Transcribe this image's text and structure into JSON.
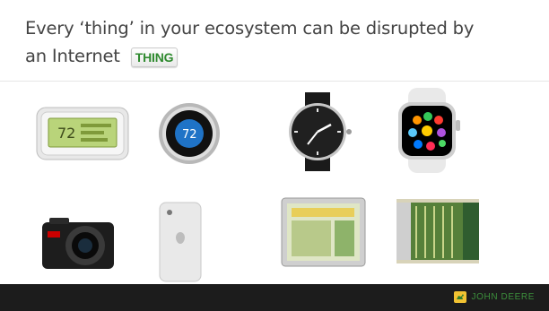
{
  "slide": {
    "title_line1": "Every ‘thing’ in your ecosystem can be disrupted by",
    "title_line2": "an Internet",
    "badge": "THING",
    "accent_color": "#2f8a2f"
  },
  "devices": {
    "thermostat_text": "72",
    "nest_text": "72"
  },
  "footer": {
    "brand": "JOHN DEERE",
    "logo_icon": "john-deere-deer-icon"
  }
}
